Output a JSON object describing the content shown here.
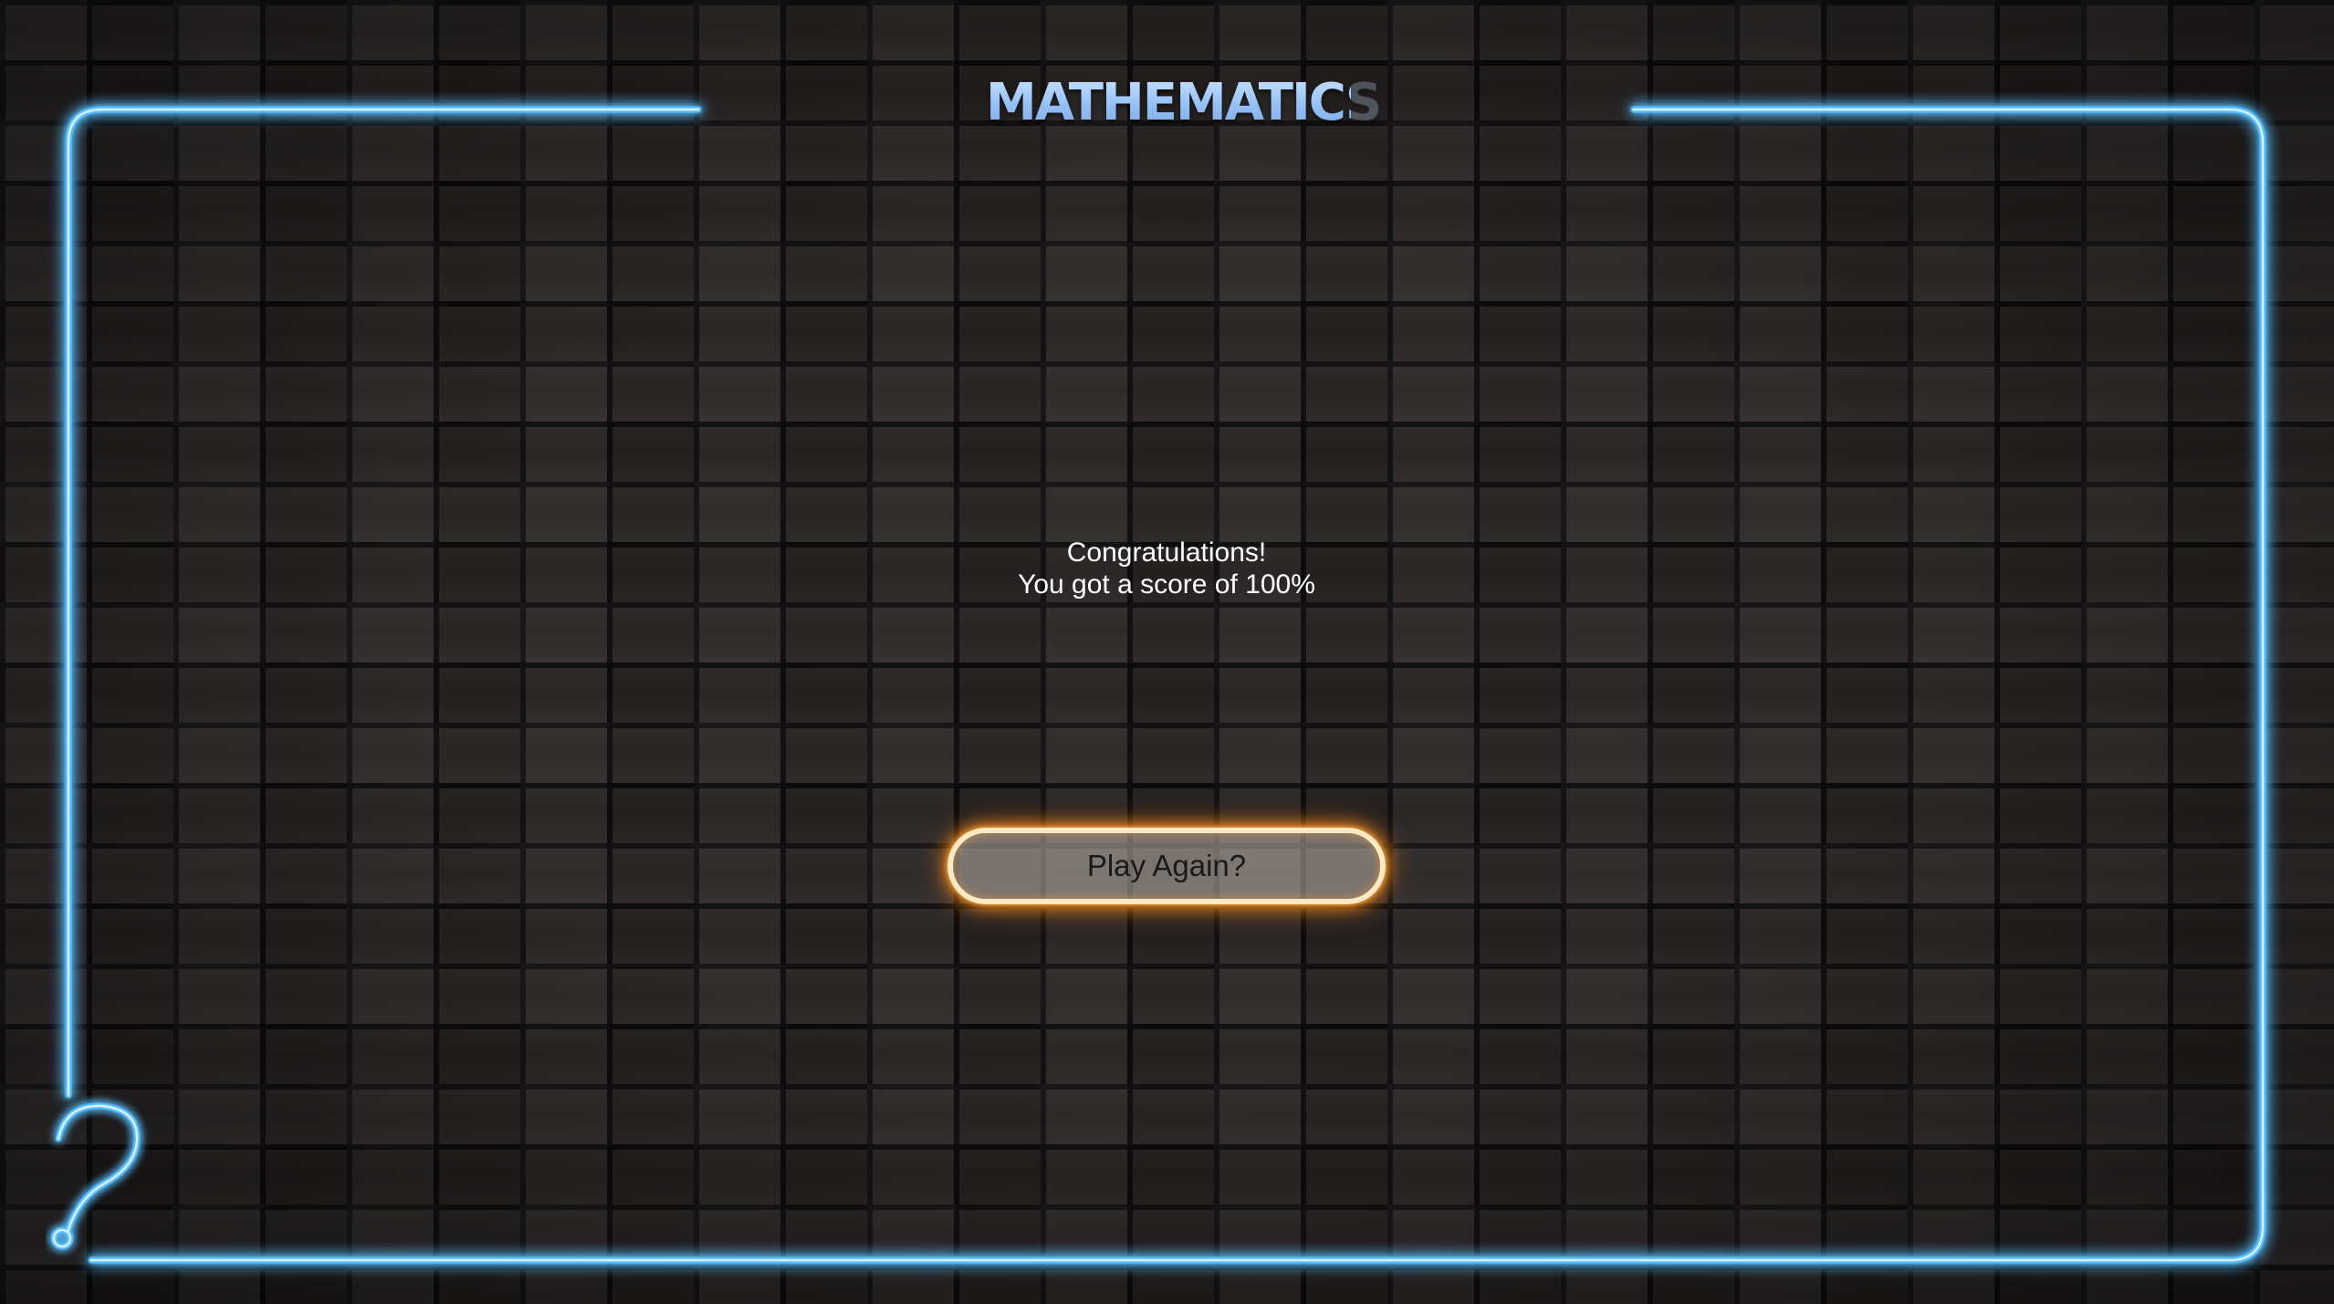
{
  "header": {
    "title": "MATHEMATICS"
  },
  "result": {
    "line1": "Congratulations!",
    "line2": "You got a score of 100%"
  },
  "actions": {
    "play_again_label": "Play Again?"
  },
  "colors": {
    "frame_neon": "#7fd0ff",
    "button_neon": "#ff8c1a",
    "title": "#9ec8ff",
    "text": "#ffffff"
  },
  "icons": {
    "corner": "question-mark-neon-icon"
  }
}
